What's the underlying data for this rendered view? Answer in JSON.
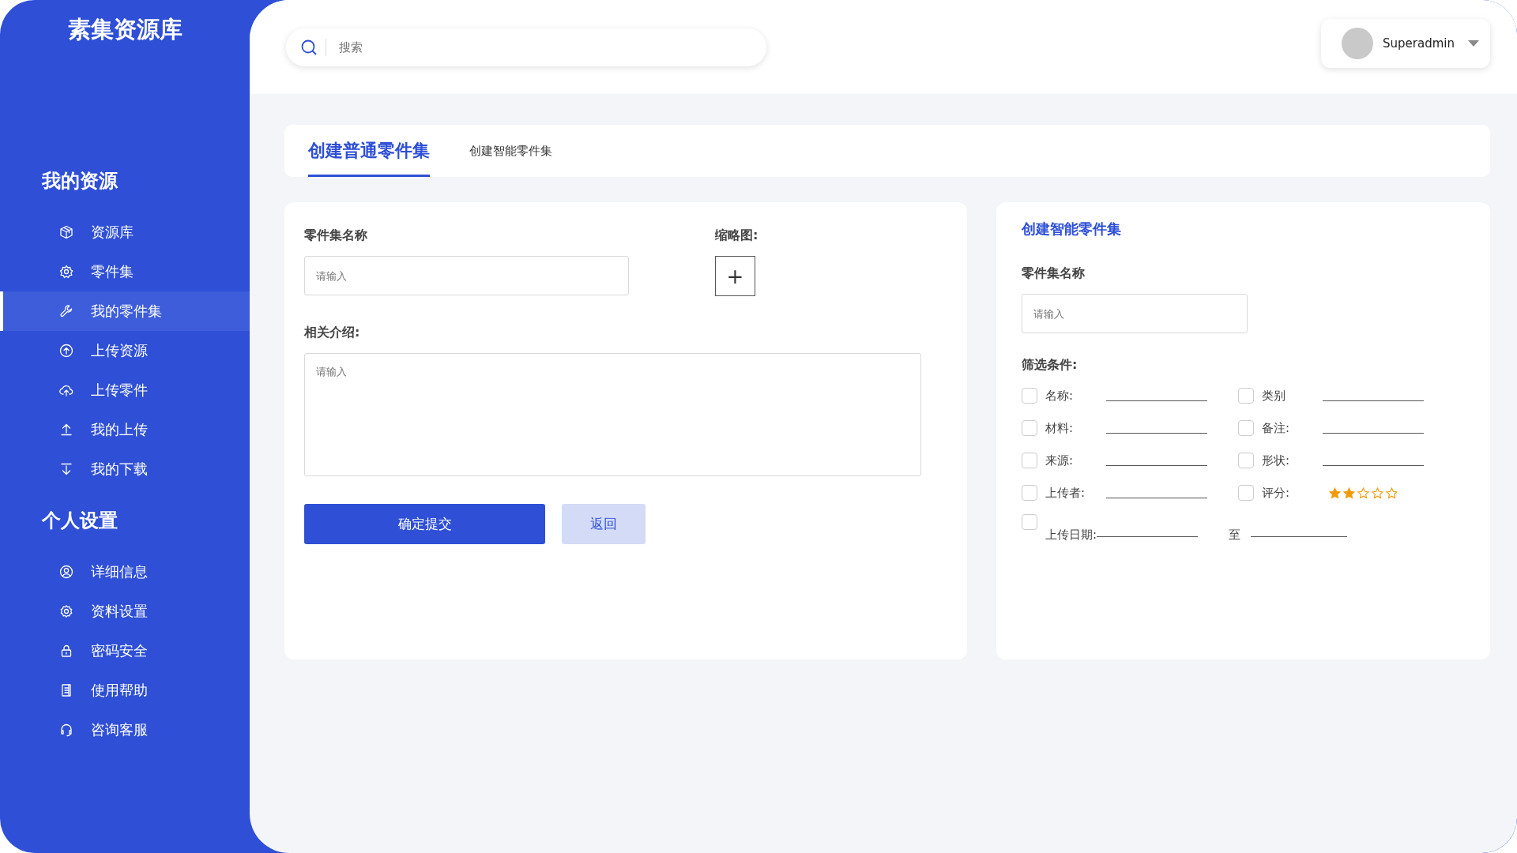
{
  "sidebar": {
    "logo": "素集资源库",
    "sections": [
      {
        "title": "我的资源",
        "items": [
          {
            "label": "资源库",
            "selected": false
          },
          {
            "label": "零件集",
            "selected": false
          },
          {
            "label": "我的零件集",
            "selected": true
          },
          {
            "label": "上传资源",
            "selected": false
          },
          {
            "label": "上传零件",
            "selected": false
          },
          {
            "label": "我的上传",
            "selected": false
          },
          {
            "label": "我的下载",
            "selected": false
          }
        ]
      },
      {
        "title": "个人设置",
        "items": [
          {
            "label": "详细信息",
            "selected": false
          },
          {
            "label": "资料设置",
            "selected": false
          },
          {
            "label": "密码安全",
            "selected": false
          },
          {
            "label": "使用帮助",
            "selected": false
          },
          {
            "label": "咨询客服",
            "selected": false
          }
        ]
      }
    ]
  },
  "header": {
    "search": {
      "placeholder": "搜索"
    },
    "user": {
      "name": "Superadmin"
    }
  },
  "tabs": [
    {
      "label": "创建普通零件集",
      "selected": true
    },
    {
      "label": "创建智能零件集",
      "selected": false
    }
  ],
  "normal_form": {
    "name_label": "零件集名称",
    "name_field": {
      "placeholder": "请输入"
    },
    "thumbnail_label": "缩略图:",
    "thumbnail_button": "+",
    "intro_label": "相关介绍:",
    "intro_field": {
      "placeholder": "请输入"
    },
    "buttons": [
      {
        "label": "确定提交",
        "kind": "primary"
      },
      {
        "label": "返回",
        "kind": "secondary"
      }
    ]
  },
  "smart_form": {
    "title": "创建智能零件集",
    "name_label": "零件集名称",
    "name_field": {
      "placeholder": "请输入"
    },
    "filter_label": "筛选条件:",
    "filters": [
      {
        "label": "名称:",
        "checked": false,
        "kind": "line"
      },
      {
        "label": "类别",
        "checked": false,
        "kind": "line"
      },
      {
        "label": "材料:",
        "checked": false,
        "kind": "line"
      },
      {
        "label": "备注:",
        "checked": false,
        "kind": "line"
      },
      {
        "label": "来源:",
        "checked": false,
        "kind": "line"
      },
      {
        "label": "形状:",
        "checked": false,
        "kind": "line"
      },
      {
        "label": "上传者:",
        "checked": false,
        "kind": "line"
      },
      {
        "label": "评分:",
        "checked": false,
        "kind": "stars",
        "stars": 2
      },
      {
        "label": "上传日期:",
        "checked": false,
        "kind": "range",
        "range_label": "至"
      }
    ]
  }
}
